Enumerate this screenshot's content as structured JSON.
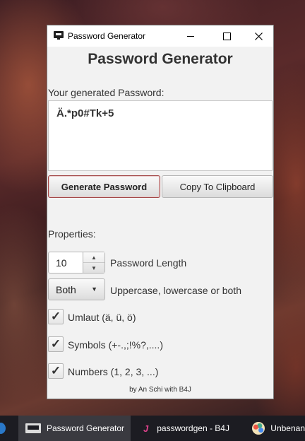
{
  "window": {
    "title": "Password Generator"
  },
  "app": {
    "heading": "Password Generator",
    "generated_label": "Your generated Password:",
    "password_value": "Ä.*p0#Tk+5",
    "generate_button": "Generate Password",
    "copy_button": "Copy To Clipboard",
    "properties_label": "Properties:",
    "length": {
      "value": "10",
      "label": "Password Length"
    },
    "case": {
      "selected": "Both",
      "label": "Uppercase, lowercase or both"
    },
    "options": [
      {
        "label": "Umlaut (ä, ü, ö)",
        "checked": true
      },
      {
        "label": "Symbols (+-.,;!%?,....)",
        "checked": true
      },
      {
        "label": "Numbers (1, 2, 3, ...)",
        "checked": true
      }
    ],
    "footer": "by An Schi with B4J"
  },
  "taskbar": {
    "items": [
      {
        "label": "Password Generator",
        "icon": "window-icon",
        "active": true
      },
      {
        "label": "passwordgen - B4J",
        "icon": "b4j-icon",
        "active": false
      },
      {
        "label": "Unbenan",
        "icon": "paint-icon",
        "active": false
      }
    ]
  },
  "colors": {
    "accent_button_border": "#a34848",
    "window_bg": "#f2f2f2",
    "taskbar_bg": "#1c1c22"
  }
}
